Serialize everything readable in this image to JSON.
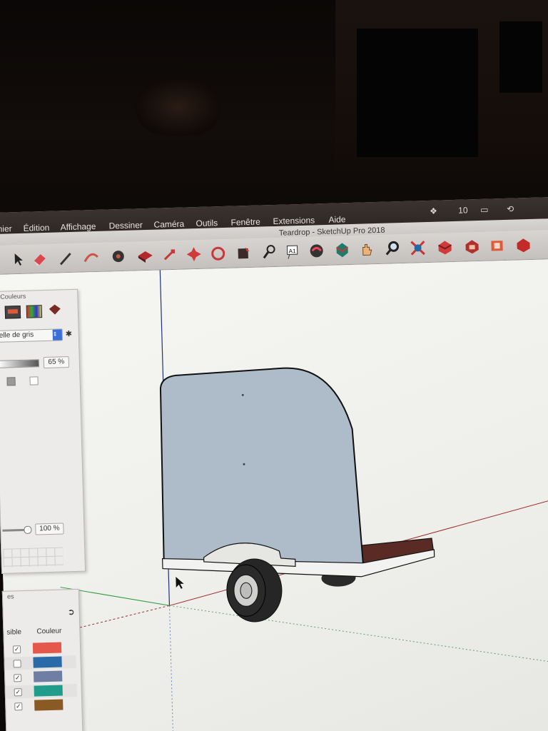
{
  "menubar": {
    "items": [
      "hier",
      "Édition",
      "Affichage",
      "Dessiner",
      "Caméra",
      "Outils",
      "Fenêtre",
      "Extensions",
      "Aide"
    ],
    "clock": "10"
  },
  "window": {
    "title": "Teardrop - SketchUp Pro 2018"
  },
  "toolbar": {
    "tools": [
      "select-icon",
      "eraser-icon",
      "pencil-icon",
      "arc-icon",
      "pushpull-icon",
      "move-icon",
      "rotate-icon",
      "scale-icon",
      "orbit-icon",
      "paint-icon",
      "tape-icon",
      "text-icon",
      "component-icon",
      "section-icon",
      "pan-icon",
      "zoom-icon",
      "zoom-extents-icon",
      "warehouse-icon",
      "extension-icon",
      "styles-icon",
      "export-icon"
    ]
  },
  "colors_panel": {
    "title": "Couleurs",
    "dropdown_value": "elle de gris",
    "opacity_value": "65 %",
    "brightness_value": "100 %"
  },
  "layers_panel": {
    "title": "es",
    "col_visible": "sible",
    "col_color": "Couleur",
    "rows": [
      {
        "checked": true,
        "color": "#e4574a"
      },
      {
        "checked": false,
        "color": "#2b6aa8"
      },
      {
        "checked": true,
        "color": "#6e7fa3"
      },
      {
        "checked": true,
        "color": "#1f9c8c"
      },
      {
        "checked": true,
        "color": "#8a5a24"
      }
    ]
  },
  "model": {
    "body_color": "#aebcc9",
    "wheel_color": "#2a2a2a",
    "deck_color": "#5a2a24"
  }
}
